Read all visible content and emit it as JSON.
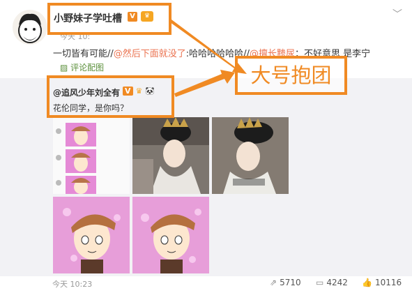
{
  "post": {
    "author": "小野妹子学吐槽",
    "verified_badge": "V",
    "time_fragment": "今天 10:",
    "text_parts": [
      {
        "t": "一切皆有可能//",
        "type": "plain"
      },
      {
        "t": "@然后下面就没了",
        "type": "mention"
      },
      {
        "t": ":哈哈哈",
        "type": "plain"
      },
      {
        "t": "哈哈哈",
        "type": "plain"
      },
      {
        "t": "//",
        "type": "plain"
      },
      {
        "t": "@擅长黪尿",
        "type": "mention"
      },
      {
        "t": "：不好意思 是李宁",
        "type": "plain"
      }
    ],
    "comment_image_link": "评论配图"
  },
  "retweet": {
    "author": "@追风少年刘全有",
    "verified_badge": "V",
    "text": "花伦同学，是你吗？"
  },
  "annotation": {
    "label": "大号抱团",
    "color": "#f08a23"
  },
  "footer": {
    "time": "今天 10:23",
    "reposts": "5710",
    "comments": "4242",
    "likes": "10116"
  },
  "icons": [
    "chevron-down-icon",
    "repost-icon",
    "comment-icon",
    "like-icon",
    "image-icon"
  ],
  "colors": {
    "mention": "#eb7350",
    "link": "#5a8f3a",
    "gray_bg": "#f2f2f5"
  }
}
